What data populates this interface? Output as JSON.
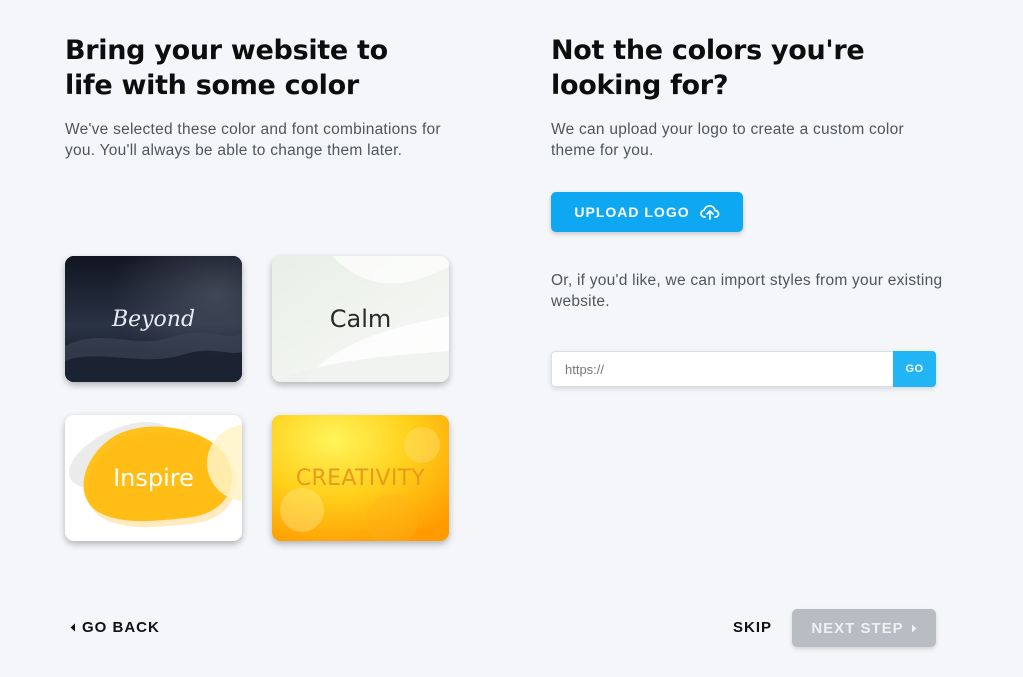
{
  "left": {
    "heading_line1": "Bring your website to",
    "heading_line2": "life with some color",
    "description": "We've selected these color and font combinations for you. You'll always be able to change them later."
  },
  "themes": [
    {
      "label": "Beyond",
      "accent": "#1c2230"
    },
    {
      "label": "Calm",
      "accent": "#f2f4f0"
    },
    {
      "label": "Inspire",
      "accent": "#ffc21c"
    },
    {
      "label": "CREATIVITY",
      "accent": "#ffb400"
    }
  ],
  "right": {
    "heading_line1": "Not the colors you're",
    "heading_line2": "looking for?",
    "description": "We can upload your logo to create a custom color theme for you.",
    "upload_label": "UPLOAD LOGO",
    "upload_icon": "cloud-upload-icon",
    "import_text": "Or, if you'd like, we can import styles from your existing website.",
    "url_placeholder": "https://",
    "url_value": "",
    "go_label": "GO"
  },
  "footer": {
    "back_label": "GO BACK",
    "back_icon": "caret-left-icon",
    "skip_label": "SKIP",
    "next_label": "NEXT STEP",
    "next_icon": "caret-right-icon"
  },
  "colors": {
    "primary_button": "#0ea8f2",
    "go_button": "#21b5f5",
    "disabled_button": "#b9bcc2",
    "background": "#f4f6fa"
  }
}
